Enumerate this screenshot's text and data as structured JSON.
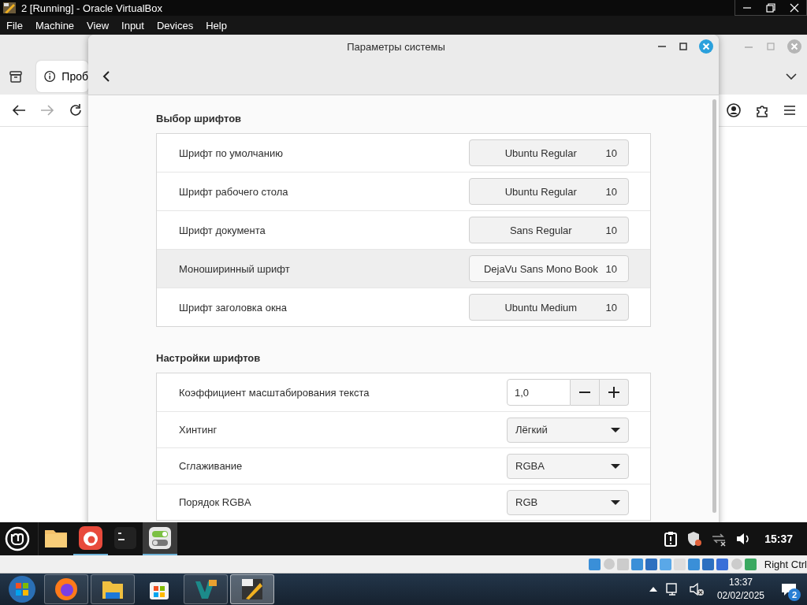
{
  "vbox": {
    "title": "2 [Running] - Oracle VirtualBox",
    "menu": [
      "File",
      "Machine",
      "View",
      "Input",
      "Devices",
      "Help"
    ]
  },
  "browser": {
    "tab_title": "Проб"
  },
  "dialog": {
    "title": "Параметры системы",
    "sections": [
      {
        "heading": "Выбор шрифтов",
        "rows": [
          {
            "kind": "font",
            "label": "Шрифт по умолчанию",
            "font": "Ubuntu Regular",
            "size": "10",
            "hovered": false
          },
          {
            "kind": "font",
            "label": "Шрифт рабочего стола",
            "font": "Ubuntu Regular",
            "size": "10",
            "hovered": false
          },
          {
            "kind": "font",
            "label": "Шрифт документа",
            "font": "Sans Regular",
            "size": "10",
            "hovered": false
          },
          {
            "kind": "font",
            "label": "Моноширинный шрифт",
            "font": "DejaVu Sans Mono Book",
            "size": "10",
            "hovered": true
          },
          {
            "kind": "font",
            "label": "Шрифт заголовка окна",
            "font": "Ubuntu Medium",
            "size": "10",
            "hovered": false
          }
        ]
      },
      {
        "heading": "Настройки шрифтов",
        "rows": [
          {
            "kind": "spin",
            "label": "Коэффициент масштабирования текста",
            "value": "1,0"
          },
          {
            "kind": "combo",
            "label": "Хинтинг",
            "value": "Лёгкий"
          },
          {
            "kind": "combo",
            "label": "Сглаживание",
            "value": "RGBA"
          },
          {
            "kind": "combo",
            "label": "Порядок RGBA",
            "value": "RGB"
          }
        ]
      }
    ]
  },
  "panel": {
    "launchers": [
      {
        "kind": "folder",
        "running": false,
        "active": false
      },
      {
        "kind": "browser",
        "running": true,
        "active": false
      },
      {
        "kind": "terminal",
        "running": false,
        "active": false
      },
      {
        "kind": "settings",
        "running": true,
        "active": true
      }
    ],
    "clock": "15:37"
  },
  "vbox_status": {
    "host_key": "Right Ctrl"
  },
  "taskbar": {
    "items": [
      {
        "kind": "firefox",
        "running": true,
        "active": false
      },
      {
        "kind": "explorer",
        "running": true,
        "active": false
      },
      {
        "kind": "store",
        "running": false,
        "active": false
      },
      {
        "kind": "designer",
        "running": true,
        "active": false
      },
      {
        "kind": "x64app",
        "running": true,
        "active": true
      }
    ],
    "time": "13:37",
    "date": "02/02/2025",
    "notifications": "2"
  }
}
